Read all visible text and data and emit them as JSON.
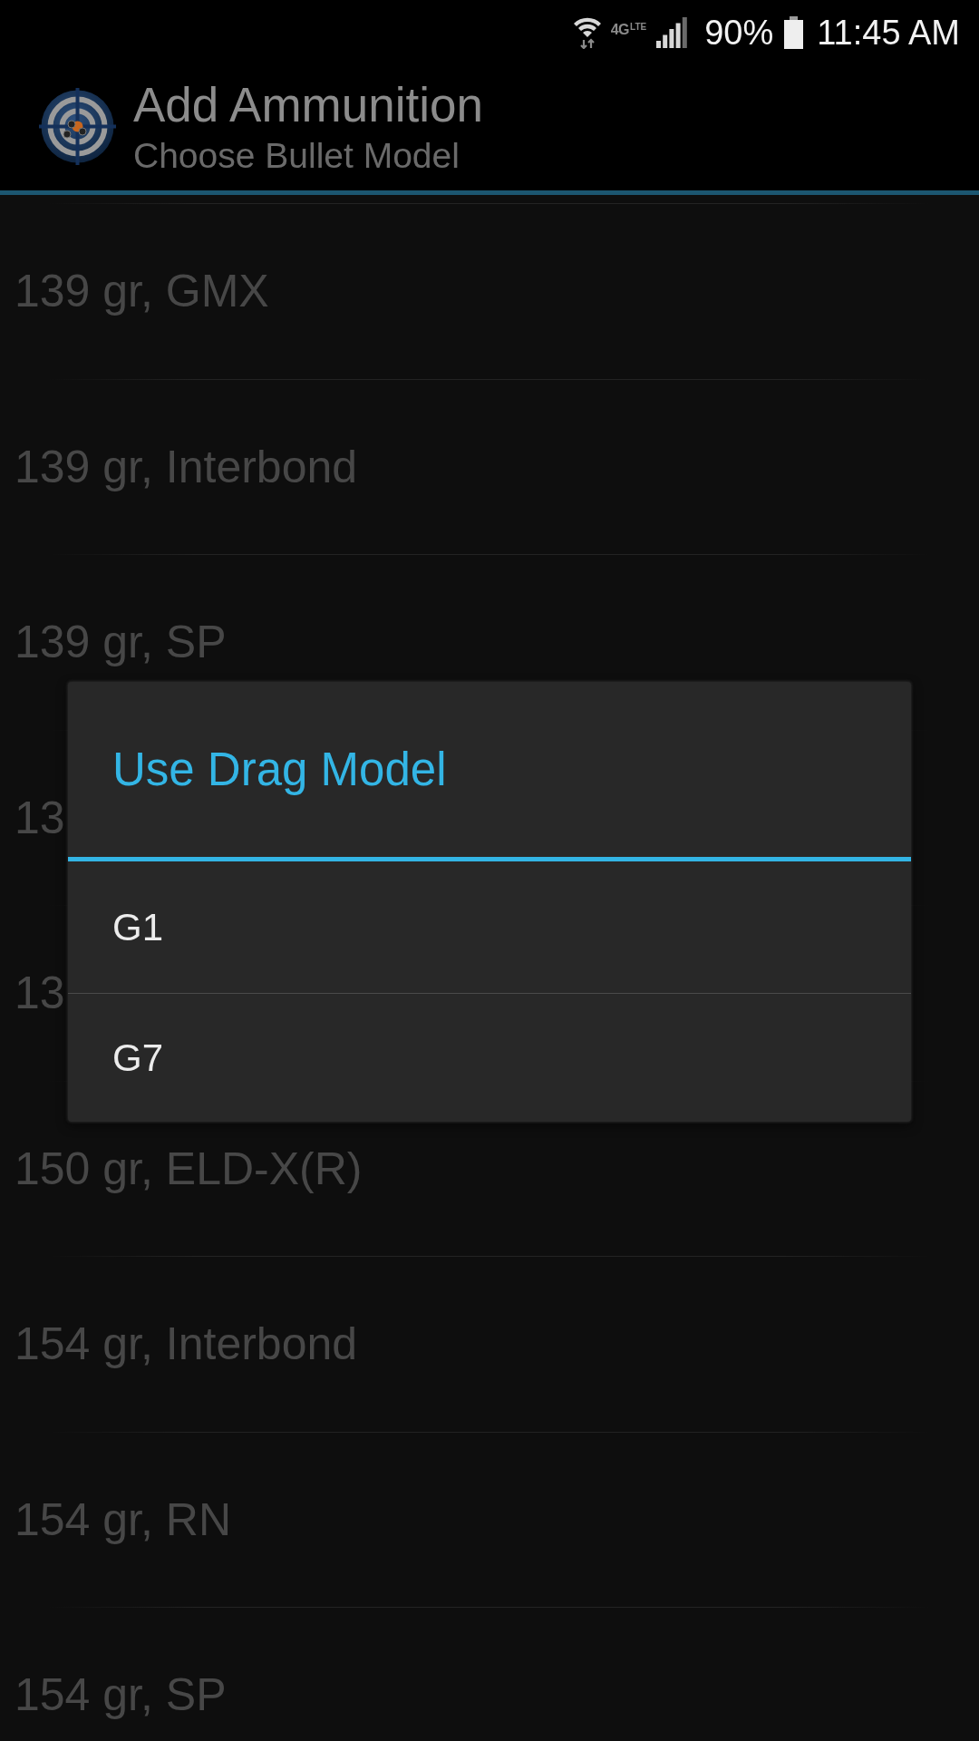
{
  "status_bar": {
    "network": "4G",
    "network_sub": "LTE",
    "battery": "90%",
    "time": "11:45 AM"
  },
  "app_bar": {
    "title": "Add Ammunition",
    "subtitle": "Choose Bullet Model"
  },
  "bullet_models": [
    "139 gr, GMX",
    "139 gr, Interbond",
    "139 gr, SP",
    "13",
    "13",
    "150 gr, ELD-X(R)",
    "154 gr, Interbond",
    "154 gr, RN",
    "154 gr, SP"
  ],
  "dialog": {
    "title": "Use Drag Model",
    "options": [
      "G1",
      "G7"
    ]
  }
}
